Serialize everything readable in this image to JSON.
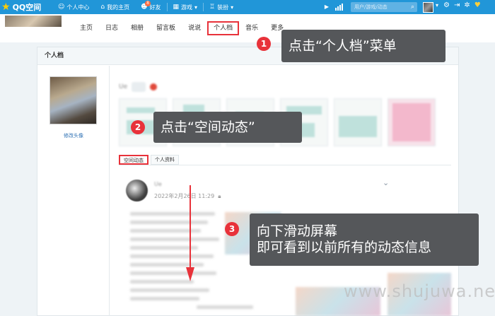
{
  "topbar": {
    "brand": "QQ空间",
    "nav": [
      {
        "icon": "user-icon",
        "label": "个人中心"
      },
      {
        "icon": "home-icon",
        "label": "我的主页"
      },
      {
        "icon": "friends-icon",
        "label": "好友",
        "badge": "8"
      },
      {
        "icon": "grid-icon",
        "label": "游戏",
        "caret": "▾"
      },
      {
        "icon": "shirt-icon",
        "label": "装扮",
        "caret": "▾"
      }
    ],
    "search_placeholder": "用户/游戏/动态",
    "accent": "#2196d8"
  },
  "tabs": [
    "主页",
    "日志",
    "相册",
    "留言板",
    "说说",
    "个人档",
    "音乐",
    "更多"
  ],
  "active_tab": "个人档",
  "panel": {
    "title": "个人档",
    "edit_avatar": "修改头像",
    "user_name": "Ue",
    "subtabs": [
      "空间动态",
      "个人资料"
    ]
  },
  "post": {
    "author": "Ue",
    "time": "2022年2月26日 11:29"
  },
  "callouts": [
    {
      "num": "1",
      "text": "点击“个人档”菜单"
    },
    {
      "num": "2",
      "text": "点击“空间动态”"
    },
    {
      "num": "3",
      "line1": "向下滑动屏幕",
      "line2": "即可看到以前所有的动态信息"
    }
  ],
  "highlight_color": "#e8323a",
  "watermark": "www.shujuwa.net"
}
